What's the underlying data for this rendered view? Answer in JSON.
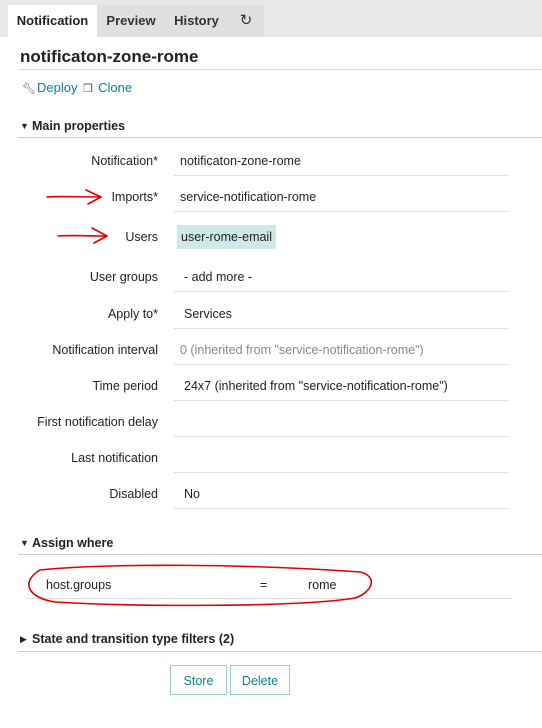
{
  "tabs": [
    {
      "label": "Notification"
    },
    {
      "label": "Preview"
    },
    {
      "label": "History"
    },
    {
      "label": "↻"
    }
  ],
  "page_title": "notificaton-zone-rome",
  "actions": {
    "deploy_label": "Deploy",
    "clone_label": "Clone"
  },
  "main_properties": {
    "heading": "Main properties",
    "fields": [
      {
        "label": "Notification*",
        "value": "notificaton-zone-rome"
      },
      {
        "label": "Imports*",
        "value": "service-notification-rome"
      },
      {
        "label": "Users",
        "value": "user-rome-email"
      },
      {
        "label": "User groups",
        "value": "- add more -"
      },
      {
        "label": "Apply to*",
        "value": "Services"
      },
      {
        "label": "Notification interval",
        "value": "0  (inherited from \"service-notification-rome\")"
      },
      {
        "label": "Time period",
        "value": "24x7 (inherited from \"service-notification-rome\")"
      },
      {
        "label": "First notification delay",
        "value": ""
      },
      {
        "label": "Last notification",
        "value": ""
      },
      {
        "label": "Disabled",
        "value": "No"
      }
    ]
  },
  "assign_where": {
    "heading": "Assign where",
    "property": "host.groups",
    "operator": "=",
    "value": "rome"
  },
  "filters": {
    "heading": "State and transition type filters (2)"
  },
  "buttons": {
    "store_label": "Store",
    "delete_label": "Delete"
  },
  "colors": {
    "accent": "#0a7f91",
    "annotation": "#e00000",
    "chip_bg": "#cfe8e8"
  }
}
